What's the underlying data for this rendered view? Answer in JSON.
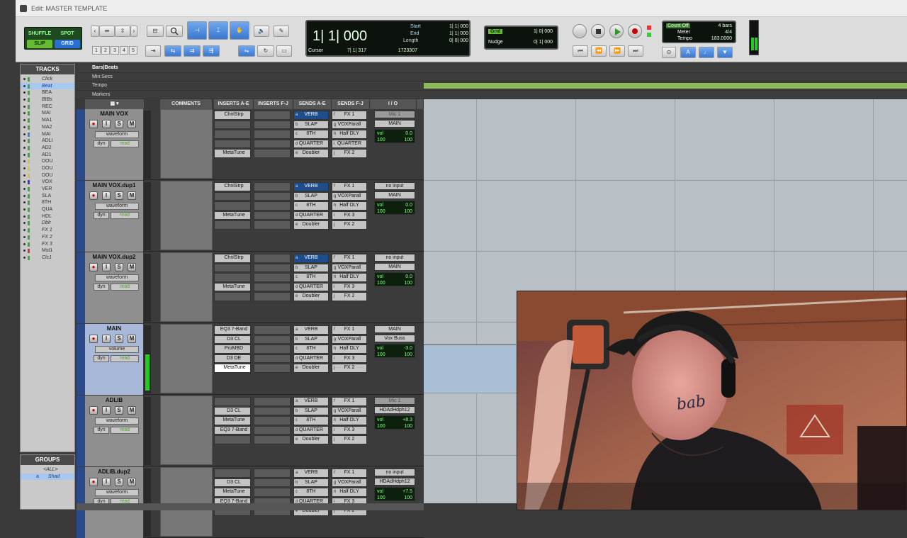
{
  "window": {
    "title": "Edit: MASTER TEMPLATE"
  },
  "toolbar": {
    "modes": {
      "shuffle": "SHUFFLE",
      "spot": "SPOT",
      "slip": "SLIP",
      "grid": "GRID"
    },
    "numbers": [
      "1",
      "2",
      "3",
      "4",
      "5"
    ],
    "counter": {
      "main": "1| 1| 000",
      "start_label": "Start",
      "start_value": "1| 1| 000",
      "end_label": "End",
      "end_value": "1| 1| 000",
      "length_label": "Length",
      "length_value": "0| 0| 000",
      "cursor_label": "Cursor",
      "cursor_value": "7| 1| 317",
      "samples_value": "1723307"
    },
    "grid": {
      "label": "Grid",
      "value": "1| 0| 000"
    },
    "nudge": {
      "label": "Nudge",
      "value": "0| 1| 000"
    },
    "count_off": {
      "label": "Count Off",
      "value": "4 bars"
    },
    "meter": {
      "label": "Meter",
      "value": "4/4"
    },
    "tempo": {
      "label": "Tempo",
      "value": "183.0000"
    }
  },
  "tracks_panel": {
    "header": "TRACKS",
    "items": [
      {
        "name": "Click",
        "italic": true,
        "color": "#3aaa3a"
      },
      {
        "name": "Beat",
        "italic": true,
        "color": "#3aaa3a",
        "highlight": true
      },
      {
        "name": "BEA",
        "color": "#3aaa3a"
      },
      {
        "name": "BtBs",
        "italic": true,
        "color": "#3aaa3a"
      },
      {
        "name": "REC",
        "color": "#3aaa3a"
      },
      {
        "name": "MAI",
        "color": "#3aaa3a"
      },
      {
        "name": "MA1",
        "color": "#3aaa3a"
      },
      {
        "name": "MA2",
        "color": "#3aaa3a"
      },
      {
        "name": "MAI",
        "color": "#4a7ad6"
      },
      {
        "name": "ADLI",
        "color": "#3aaa3a"
      },
      {
        "name": "AD2",
        "color": "#3aaa3a"
      },
      {
        "name": "AD1",
        "color": "#3aaa3a"
      },
      {
        "name": "DOU",
        "color": "#d6c43a"
      },
      {
        "name": "DOU",
        "color": "#d6c43a"
      },
      {
        "name": "DOU",
        "color": "#d6c43a"
      },
      {
        "name": "VOX",
        "color": "#3a3ad6"
      },
      {
        "name": "VER",
        "color": "#3aaa3a"
      },
      {
        "name": "SLA",
        "color": "#3aaa3a"
      },
      {
        "name": "8TH",
        "color": "#3aaa3a"
      },
      {
        "name": "QUA",
        "color": "#3aaa3a"
      },
      {
        "name": "HDL",
        "color": "#3aaa3a"
      },
      {
        "name": "Dblr",
        "italic": true,
        "color": "#3aaa3a"
      },
      {
        "name": "FX 1",
        "italic": true,
        "color": "#3aaa3a"
      },
      {
        "name": "FX 2",
        "italic": true,
        "color": "#3aaa3a"
      },
      {
        "name": "FX 3",
        "italic": true,
        "color": "#3aaa3a"
      },
      {
        "name": "Mst1",
        "color": "#c83a3a"
      },
      {
        "name": "Clc1",
        "italic": true,
        "color": "#3aaa3a"
      }
    ]
  },
  "groups_panel": {
    "header": "GROUPS",
    "items": [
      {
        "label": "<ALL>",
        "highlight": false
      },
      {
        "label": "Shad",
        "highlight": true,
        "prefix": "a"
      }
    ]
  },
  "rulers": [
    "Bars|Beats",
    "Min:Secs",
    "Tempo",
    "Markers"
  ],
  "columns": {
    "comments": "COMMENTS",
    "inserts_ae": "INSERTS A-E",
    "inserts_fj": "INSERTS F-J",
    "sends_ae": "SENDS A-E",
    "sends_fj": "SENDS F-J",
    "io": "I / O"
  },
  "mix_tracks": [
    {
      "name": "MAIN VOX",
      "view": "waveform",
      "auto": "read",
      "dyn": "dyn",
      "selected": false,
      "meter": 0,
      "inserts_ae": [
        "ChnlStrp",
        "",
        "",
        "",
        "MetaTune"
      ],
      "inserts_fj": [
        "",
        "",
        "",
        "",
        ""
      ],
      "sends_ae": [
        "VERB",
        "SLAP",
        "8TH",
        "QUARTER",
        "Doubler"
      ],
      "sends_fj": [
        "FX 1",
        "VOXParall",
        "Half DLY",
        "QUARTER",
        "FX 2"
      ],
      "io_in": "Mic 1",
      "io_in_dim": true,
      "io_out": "MAIN",
      "vol": "0.0",
      "pan_l": "100",
      "pan_r": "100"
    },
    {
      "name": "MAIN VOX.dup1",
      "view": "waveform",
      "auto": "read",
      "dyn": "dyn",
      "selected": false,
      "meter": 0,
      "inserts_ae": [
        "ChnlStrp",
        "",
        "",
        "MetaTune",
        ""
      ],
      "inserts_fj": [
        "",
        "",
        "",
        "",
        ""
      ],
      "sends_ae": [
        "VERB",
        "SLAP",
        "8TH",
        "QUARTER",
        "Doubler"
      ],
      "sends_fj": [
        "FX 1",
        "VOXParall",
        "Half DLY",
        "FX 3",
        "FX 2"
      ],
      "io_in": "no input",
      "io_in_dim": false,
      "io_out": "MAIN",
      "vol": "0.0",
      "pan_l": "100",
      "pan_r": "100"
    },
    {
      "name": "MAIN VOX.dup2",
      "view": "waveform",
      "auto": "read",
      "dyn": "dyn",
      "selected": false,
      "meter": 0,
      "inserts_ae": [
        "ChnlStrp",
        "",
        "",
        "MetaTune",
        ""
      ],
      "inserts_fj": [
        "",
        "",
        "",
        "",
        ""
      ],
      "sends_ae": [
        "VERB",
        "SLAP",
        "8TH",
        "QUARTER",
        "Doubler"
      ],
      "sends_fj": [
        "FX 1",
        "VOXParall",
        "Half DLY",
        "FX 3",
        "FX 2"
      ],
      "io_in": "no input",
      "io_in_dim": false,
      "io_out": "MAIN",
      "vol": "0.0",
      "pan_l": "100",
      "pan_r": "100"
    },
    {
      "name": "MAIN",
      "view": "volume",
      "auto": "read",
      "dyn": "dyn",
      "selected": true,
      "meter": 0.55,
      "inserts_ae": [
        "EQ3 7-Band",
        "D3 CL",
        "ProMBD",
        "D3 DE",
        "MetaTune"
      ],
      "inserts_fj": [
        "",
        "",
        "",
        "",
        ""
      ],
      "sends_ae": [
        "VERB",
        "SLAP",
        "8TH",
        "QUARTER",
        "Doubler"
      ],
      "sends_fj": [
        "FX 1",
        "VOXParall",
        "Half DLY",
        "FX 3",
        "FX 2"
      ],
      "io_in": "MAIN",
      "io_in_dim": false,
      "io_out": "Vox Buss",
      "vol": "-3.0",
      "pan_l": "100",
      "pan_r": "100"
    },
    {
      "name": "ADLIB",
      "view": "waveform",
      "auto": "read",
      "dyn": "dyn",
      "selected": false,
      "meter": 0,
      "inserts_ae": [
        "",
        "D3 CL",
        "MetaTune",
        "EQ3 7-Band",
        ""
      ],
      "inserts_fj": [
        "",
        "",
        "",
        "",
        ""
      ],
      "sends_ae": [
        "VERB",
        "SLAP",
        "8TH",
        "QUARTER",
        "Doubler"
      ],
      "sends_fj": [
        "FX 1",
        "VOXParall",
        "Half DLY",
        "FX 3",
        "FX 2"
      ],
      "io_in": "Mic 1",
      "io_in_dim": true,
      "io_out": "HDAdHdph12",
      "vol": "+8.3",
      "pan_l": "100",
      "pan_r": "100"
    },
    {
      "name": "ADLIB.dup2",
      "view": "waveform",
      "auto": "read",
      "dyn": "dyn",
      "selected": false,
      "meter": 0,
      "inserts_ae": [
        "",
        "D3 CL",
        "MetaTune",
        "EQ3 7-Band",
        ""
      ],
      "inserts_fj": [
        "",
        "",
        "",
        "",
        ""
      ],
      "sends_ae": [
        "VERB",
        "SLAP",
        "8TH",
        "QUARTER",
        "Doubler"
      ],
      "sends_fj": [
        "FX 1",
        "VOXParall",
        "Half DLY",
        "FX 3",
        "FX 2"
      ],
      "io_in": "no input",
      "io_in_dim": false,
      "io_out": "HDAdHdph12",
      "vol": "+7.5",
      "pan_l": "100",
      "pan_r": "100"
    }
  ],
  "webcam": {
    "cap_text": "",
    "tattoo_text": "bab"
  }
}
